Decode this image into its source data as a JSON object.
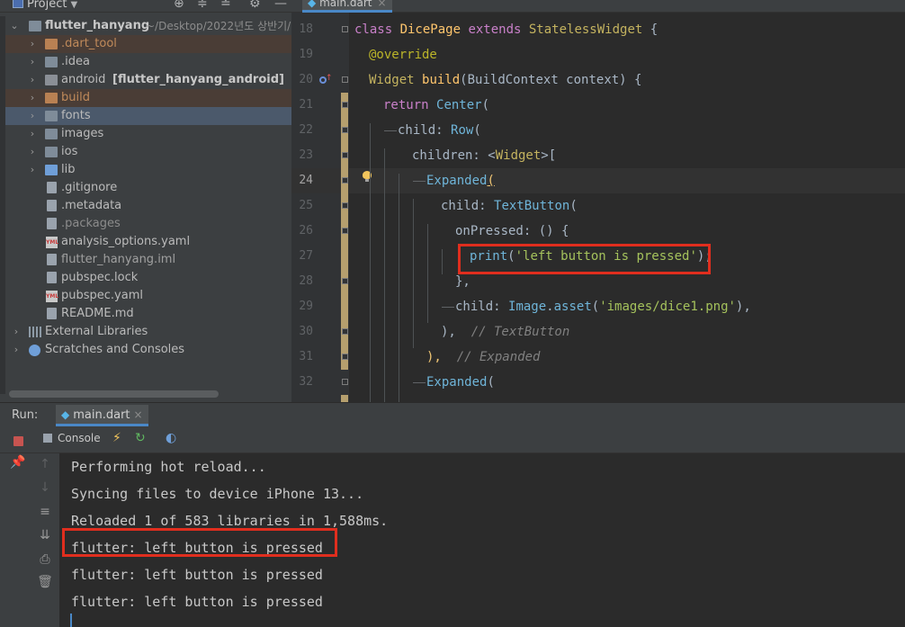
{
  "project": {
    "title": "Project",
    "tree": [
      {
        "label": "flutter_hanyang",
        "path": "~/Desktop/2022년도 상반기/",
        "arrow": "⌄",
        "icon": "folder"
      },
      {
        "label": ".dart_tool",
        "arrow": "›",
        "icon": "folder-orange"
      },
      {
        "label": ".idea",
        "arrow": "›",
        "icon": "folder"
      },
      {
        "label": "android",
        "bold_suffix": "[flutter_hanyang_android]",
        "arrow": "›",
        "icon": "folder-bold"
      },
      {
        "label": "build",
        "arrow": "›",
        "icon": "folder-orange"
      },
      {
        "label": "fonts",
        "arrow": "›",
        "icon": "folder"
      },
      {
        "label": "images",
        "arrow": "›",
        "icon": "folder"
      },
      {
        "label": "ios",
        "arrow": "›",
        "icon": "folder"
      },
      {
        "label": "lib",
        "arrow": "›",
        "icon": "folder-blue"
      },
      {
        "label": ".gitignore",
        "icon": "file"
      },
      {
        "label": ".metadata",
        "icon": "file"
      },
      {
        "label": ".packages",
        "icon": "file"
      },
      {
        "label": "analysis_options.yaml",
        "icon": "yaml"
      },
      {
        "label": "flutter_hanyang.iml",
        "icon": "file"
      },
      {
        "label": "pubspec.lock",
        "icon": "file"
      },
      {
        "label": "pubspec.yaml",
        "icon": "yaml"
      },
      {
        "label": "README.md",
        "icon": "file"
      },
      {
        "label": "External Libraries",
        "arrow": "›",
        "icon": "library"
      },
      {
        "label": "Scratches and Consoles",
        "arrow": "›",
        "icon": "scratch"
      }
    ]
  },
  "editor": {
    "tab_label": "main.dart",
    "line_numbers": [
      "18",
      "19",
      "20",
      "21",
      "22",
      "23",
      "24",
      "25",
      "26",
      "27",
      "28",
      "29",
      "30",
      "31",
      "32"
    ],
    "current_line": "24",
    "code": {
      "l18": {
        "kw": "class ",
        "name": "DicePage ",
        "kw2": "extends ",
        "parent": "StatelessWidget ",
        "rest": "{"
      },
      "l19": {
        "ann": "@override"
      },
      "l20": {
        "type": "Widget ",
        "fn": "build",
        "rest": "(BuildContext context) {"
      },
      "l21": {
        "kw": "return ",
        "fn": "Center",
        "rest": "("
      },
      "l22": {
        "pre": "child: ",
        "fn": "Row",
        "rest": "("
      },
      "l23": {
        "pre": "children: <",
        "type": "Widget",
        "rest": ">["
      },
      "l24": {
        "fn": "Expanded",
        "rest": "("
      },
      "l25": {
        "pre": "child: ",
        "fn": "TextButton",
        "rest": "("
      },
      "l26": {
        "pre": "onPressed: () {"
      },
      "l27": {
        "fn": "print",
        "open": "(",
        "str": "'left button is pressed'",
        "rest": ");"
      },
      "l28": {
        "pre": "},"
      },
      "l29": {
        "pre": "child: ",
        "fn": "Image",
        "dot": ".",
        "fn2": "asset",
        "open": "(",
        "str": "'images/dice1.png'",
        "rest": "),"
      },
      "l30": {
        "pre": "),  ",
        "cmt": "// TextButton"
      },
      "l31": {
        "pre": "),  ",
        "cmt": "// Expanded"
      },
      "l32": {
        "fn": "Expanded",
        "rest": "("
      }
    }
  },
  "run": {
    "label": "Run:",
    "tab_label": "main.dart",
    "console_label": "Console",
    "output": [
      "Performing hot reload...",
      "Syncing files to device iPhone 13...",
      "Reloaded 1 of 583 libraries in 1,588ms.",
      "flutter: left button is pressed",
      "flutter: left button is pressed",
      "flutter: left button is pressed"
    ]
  },
  "colors": {
    "highlight_box": "#e02e1e",
    "accent": "#4a88c7"
  }
}
